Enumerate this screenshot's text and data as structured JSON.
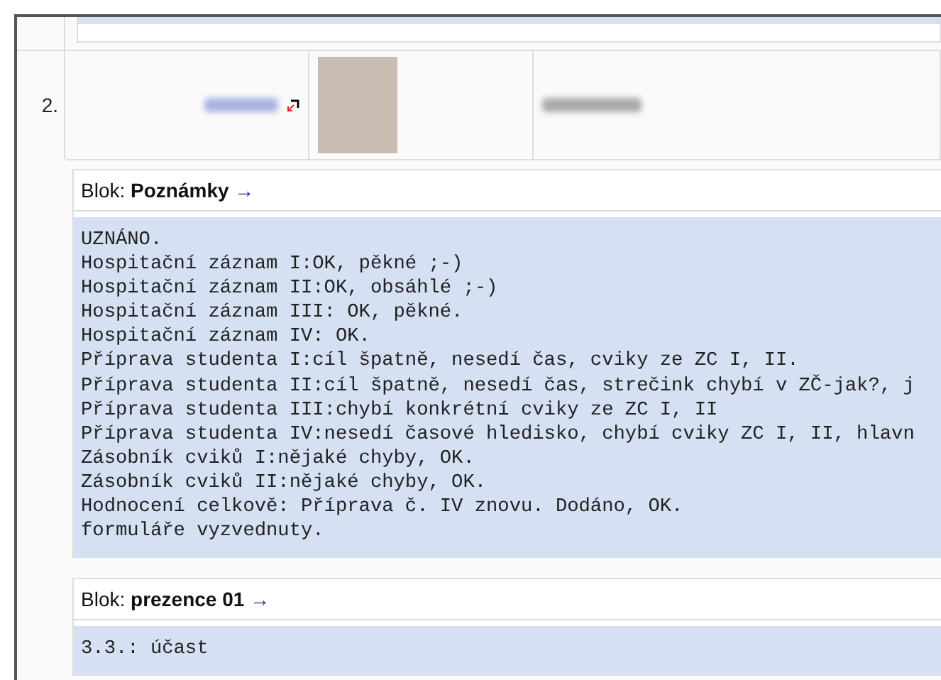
{
  "row": {
    "number": "2."
  },
  "blocks": [
    {
      "label": "Blok:",
      "name": "Poznámky",
      "arrow": "→",
      "lines": [
        "UZNÁNO.",
        "Hospitační záznam I:OK, pěkné ;-)",
        "Hospitační záznam II:OK, obsáhlé ;-)",
        "Hospitační záznam III: OK, pěkné.",
        "Hospitační záznam IV: OK.",
        "Příprava studenta I:cíl špatně, nesedí čas, cviky ze ZC I, II.",
        "Příprava studenta II:cíl špatně, nesedí čas, strečink chybí v ZČ-jak?, j",
        "Příprava studenta III:chybí konkrétní cviky ze ZC I, II",
        "Příprava studenta IV:nesedí časové hledisko, chybí cviky ZC I, II, hlavn",
        "Zásobník cviků I:nějaké chyby, OK.",
        "Zásobník cviků II:nějaké chyby, OK.",
        "Hodnocení celkově: Příprava č. IV znovu. Dodáno, OK.",
        "formuláře vyzvednuty."
      ]
    },
    {
      "label": "Blok:",
      "name": "prezence 01",
      "arrow": "→",
      "lines": [
        "3.3.: účast"
      ]
    }
  ]
}
